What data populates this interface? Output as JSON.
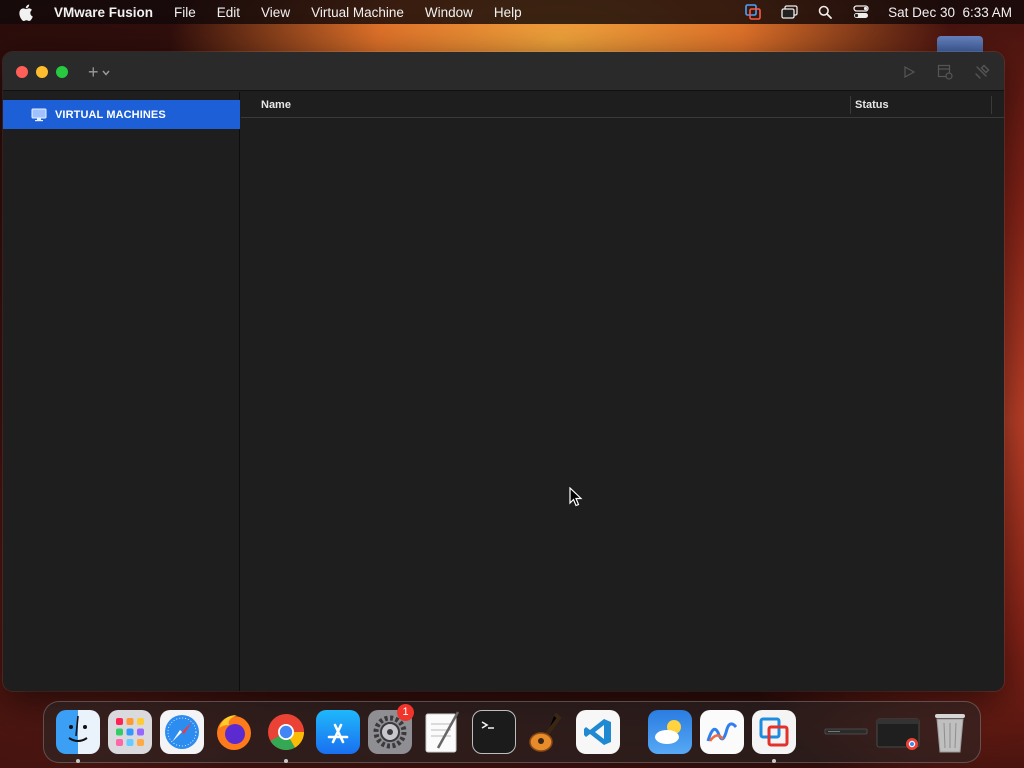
{
  "menubar": {
    "app_name": "VMware Fusion",
    "menus": [
      "File",
      "Edit",
      "View",
      "Virtual Machine",
      "Window",
      "Help"
    ],
    "datetime": "Sat Dec 30  6:33 AM"
  },
  "window": {
    "add_button_label": "+",
    "sidebar": {
      "items": [
        {
          "label": "VIRTUAL MACHINES",
          "icon": "monitor-icon",
          "selected": true
        }
      ]
    },
    "table": {
      "columns": [
        "Name",
        "Status"
      ],
      "rows": []
    }
  },
  "dock": {
    "apps": [
      {
        "name": "Finder",
        "icon": "finder-icon",
        "running": true
      },
      {
        "name": "Launchpad",
        "icon": "launchpad-icon",
        "running": false
      },
      {
        "name": "Safari",
        "icon": "safari-icon",
        "running": false
      },
      {
        "name": "Firefox",
        "icon": "firefox-icon",
        "running": false
      },
      {
        "name": "Google Chrome",
        "icon": "chrome-icon",
        "running": true
      },
      {
        "name": "App Store",
        "icon": "app-store-icon",
        "running": false
      },
      {
        "name": "System Settings",
        "icon": "system-settings-icon",
        "running": false,
        "badge": "1"
      },
      {
        "name": "TextEdit",
        "icon": "textedit-icon",
        "running": false
      },
      {
        "name": "Terminal",
        "icon": "terminal-icon",
        "running": false
      },
      {
        "name": "GarageBand",
        "icon": "garageband-icon",
        "running": false
      },
      {
        "name": "Visual Studio Code",
        "icon": "vscode-icon",
        "running": false
      },
      {
        "name": "Weather",
        "icon": "weather-icon",
        "running": false
      },
      {
        "name": "Freeform",
        "icon": "freeform-icon",
        "running": false
      },
      {
        "name": "VMware Fusion",
        "icon": "vmware-fusion-icon",
        "running": true
      }
    ],
    "others": [
      {
        "name": "Minimized window",
        "icon": "minimized-window-icon"
      },
      {
        "name": "Chrome window",
        "icon": "chrome-window-thumbnail-icon"
      },
      {
        "name": "Trash",
        "icon": "trash-icon"
      }
    ]
  },
  "colors": {
    "selection": "#1d5fd6",
    "close": "#ff5f57",
    "minimize": "#febc2e",
    "maximize": "#28c840"
  }
}
